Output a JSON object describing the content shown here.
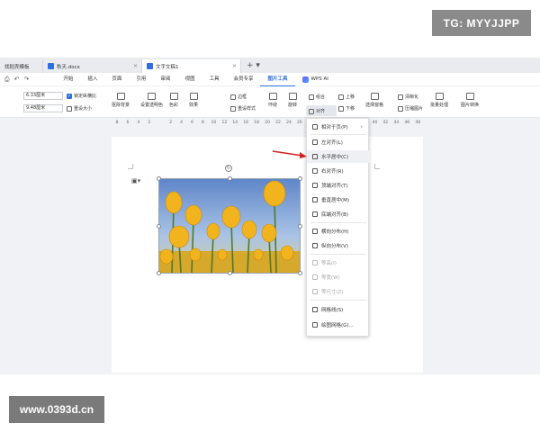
{
  "watermarks": {
    "tg": "TG: MYYJJPP",
    "site": "www.0393d.cn"
  },
  "tabs": [
    {
      "label": "找稻壳模板",
      "color": "#e8562a"
    },
    {
      "label": "秋天.docx",
      "color": "#2d6fe0"
    },
    {
      "label": "文字文稿1",
      "color": "#2d6fe0"
    }
  ],
  "menu": {
    "items": [
      "开始",
      "插入",
      "页面",
      "引用",
      "审阅",
      "视图",
      "工具",
      "会员专享",
      "图片工具"
    ],
    "active": "图片工具",
    "wps_ai": "WPS AI"
  },
  "ribbon": {
    "width_value": "6.33厘米",
    "height_value": "9.48厘米",
    "lock_ratio": "锁定纵横比",
    "reset_size": "重设大小",
    "remove_bg": "抠除背景",
    "transparent": "设置透明色",
    "color": "色彩",
    "effects": "效果",
    "border": "边框",
    "reset_style": "重设样式",
    "wrap": "环绕",
    "rotate": "旋转",
    "align": "对齐",
    "group": "组合",
    "bring_up": "上移",
    "send_down": "下移",
    "select_pane": "选择窗格",
    "clarity": "清晰化",
    "compress": "压缩图片",
    "batch": "批量处理",
    "convert": "图片转换"
  },
  "ruler": [
    "8",
    "6",
    "4",
    "2",
    "",
    "2",
    "4",
    "6",
    "8",
    "10",
    "12",
    "14",
    "16",
    "18",
    "20",
    "22",
    "24",
    "26",
    "28",
    "30",
    "32",
    "34",
    "36",
    "38",
    "40",
    "42",
    "44",
    "46",
    "48"
  ],
  "align_menu": {
    "items": [
      {
        "label": "相对于页(P)",
        "disabled": false,
        "submenu": true
      },
      {
        "label": "左对齐(L)",
        "disabled": false
      },
      {
        "label": "水平居中(C)",
        "disabled": false,
        "highlighted": true
      },
      {
        "label": "右对齐(R)",
        "disabled": false
      },
      {
        "label": "顶端对齐(T)",
        "disabled": false
      },
      {
        "label": "垂直居中(M)",
        "disabled": false
      },
      {
        "label": "底端对齐(B)",
        "disabled": false
      },
      {
        "label": "横向分布(H)",
        "disabled": false
      },
      {
        "label": "纵向分布(V)",
        "disabled": false
      },
      {
        "label": "等高(I)",
        "disabled": true
      },
      {
        "label": "等宽(W)",
        "disabled": true
      },
      {
        "label": "等尺寸(Z)",
        "disabled": true
      },
      {
        "label": "网格线(S)",
        "disabled": false
      },
      {
        "label": "绘图网格(G)...",
        "disabled": false
      }
    ]
  },
  "colors": {
    "accent": "#2d6fe0",
    "arrow": "#d32020"
  }
}
